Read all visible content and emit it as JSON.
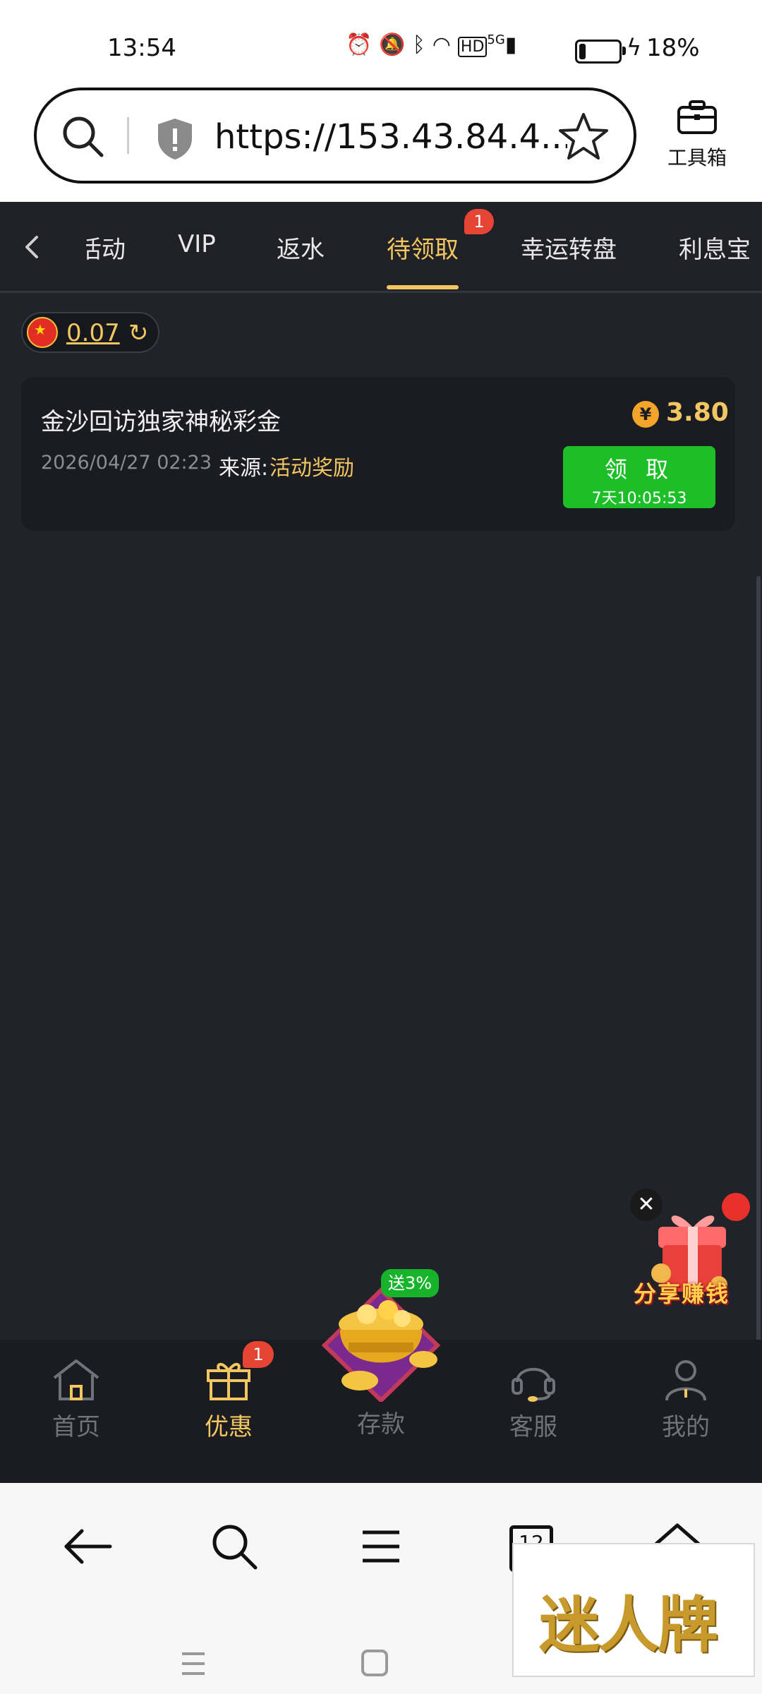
{
  "status_bar": {
    "time": "13:54",
    "network": "5G",
    "battery_percent": "18%",
    "battery_level": 0.18
  },
  "browser": {
    "url": "https://153.43.84.4...",
    "toolbox_label": "工具箱"
  },
  "tabs": {
    "items": [
      {
        "label": "活动"
      },
      {
        "label": "VIP"
      },
      {
        "label": "返水"
      },
      {
        "label": "待领取"
      },
      {
        "label": "幸运转盘"
      },
      {
        "label": "利息宝"
      }
    ],
    "active_index": 3,
    "active_badge": "1"
  },
  "balance": {
    "amount": "0.07",
    "currency_flag": "china-flag-icon"
  },
  "reward_card": {
    "title": "金沙回访独家神秘彩金",
    "date": "2026/04/27 02:23",
    "source_label": "来源:",
    "source_value": "活动奖励",
    "coin_symbol": "¥",
    "amount": "3.80",
    "claim_label": "领 取",
    "claim_countdown": "7天10:05:53"
  },
  "share_widget": {
    "label": "分享赚钱"
  },
  "bottom_nav": {
    "items": [
      {
        "label": "首页"
      },
      {
        "label": "优惠"
      },
      {
        "label": "存款"
      },
      {
        "label": "客服"
      },
      {
        "label": "我的"
      }
    ],
    "active_index": 1,
    "promo_badge": "1",
    "deposit_tag": "送3%"
  },
  "browser_bottom": {
    "tab_count": "12"
  },
  "watermark": {
    "text": "迷人牌"
  },
  "colors": {
    "accent_gold": "#f2c660",
    "claim_green": "#1cbf27",
    "badge_red": "#e64536",
    "app_bg": "#21232a"
  }
}
